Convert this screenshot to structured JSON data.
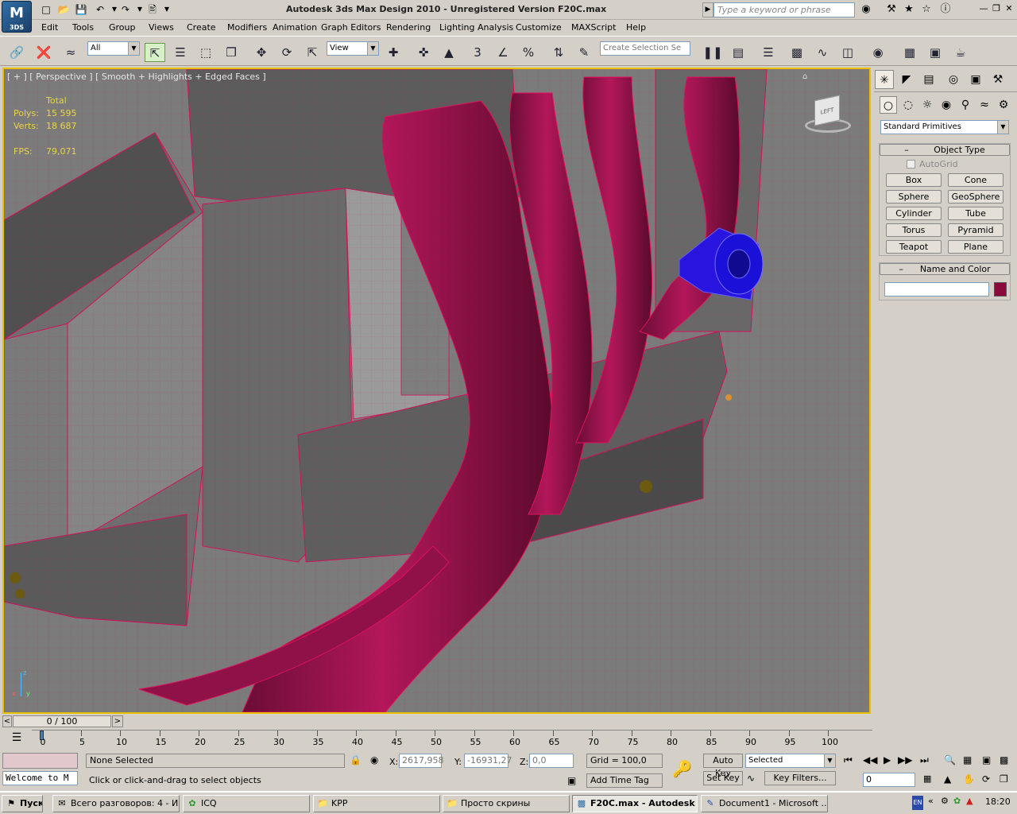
{
  "app": {
    "title": "Autodesk 3ds Max Design 2010  - Unregistered Version    F20C.max",
    "logo_text": "M",
    "logo_sub": "3DS",
    "search_placeholder": "Type a keyword or phrase"
  },
  "menu": [
    "Edit",
    "Tools",
    "Group",
    "Views",
    "Create",
    "Modifiers",
    "Animation",
    "Graph Editors",
    "Rendering",
    "Lighting Analysis",
    "Customize",
    "MAXScript",
    "Help"
  ],
  "toolbar": {
    "selection_filter": "All",
    "ref_coord": "View",
    "selection_set_placeholder": "Create Selection Se",
    "snap_label": "3"
  },
  "viewport": {
    "label": "[ + ] [ Perspective ] [ Smooth + Highlights + Edged Faces ]",
    "stats_header": "Total",
    "polys_label": "Polys:",
    "polys_value": "15 595",
    "verts_label": "Verts:",
    "verts_value": "18 687",
    "fps_label": "FPS:",
    "fps_value": "79,071",
    "viewcube_face": "LEFT",
    "axis_z": "z",
    "axis_x": "x",
    "axis_y": "y"
  },
  "command_panel": {
    "category": "Standard Primitives",
    "object_type_title": "Object Type",
    "autogrid_label": "AutoGrid",
    "primitives": [
      "Box",
      "Cone",
      "Sphere",
      "GeoSphere",
      "Cylinder",
      "Tube",
      "Torus",
      "Pyramid",
      "Teapot",
      "Plane"
    ],
    "name_color_title": "Name and Color",
    "name_value": "",
    "object_color": "#8b0a3c"
  },
  "timeline": {
    "slider_label": "0 / 100",
    "ticks": [
      "0",
      "5",
      "10",
      "15",
      "20",
      "25",
      "30",
      "35",
      "40",
      "45",
      "50",
      "55",
      "60",
      "65",
      "70",
      "75",
      "80",
      "85",
      "90",
      "95",
      "100"
    ],
    "prev_arrow": "<",
    "next_arrow": ">"
  },
  "status": {
    "welcome": "Welcome to M",
    "selection": "None Selected",
    "prompt": "Click or click-and-drag to select objects",
    "x_label": "X:",
    "x_value": "2617,958",
    "y_label": "Y:",
    "y_value": "-16931,27",
    "z_label": "Z:",
    "z_value": "0,0",
    "grid": "Grid = 100,0",
    "add_time_tag": "Add Time Tag",
    "auto_key": "Auto Key",
    "set_key": "Set Key",
    "key_mode": "Selected",
    "key_filters": "Key Filters...",
    "frame": "0"
  },
  "taskbar": {
    "start": "Пуск",
    "tasks": [
      {
        "label": "Всего разговоров: 4 - И...",
        "icon": "chat-icon"
      },
      {
        "label": "ICQ",
        "icon": "flower-icon"
      },
      {
        "label": "KPP",
        "icon": "folder-icon"
      },
      {
        "label": "Просто скрины",
        "icon": "folder-icon"
      },
      {
        "label": "F20C.max - Autodesk ...",
        "icon": "max-icon"
      },
      {
        "label": "Document1 - Microsoft ...",
        "icon": "word-icon"
      }
    ],
    "lang": "EN",
    "clock": "18:20"
  },
  "colors": {
    "mesh_wire": "#e0105a",
    "pipe": "#a0154f",
    "selection_blue": "#1a10d8",
    "viewport_bg": "#7b7b7b",
    "active_border": "#e8c000"
  }
}
